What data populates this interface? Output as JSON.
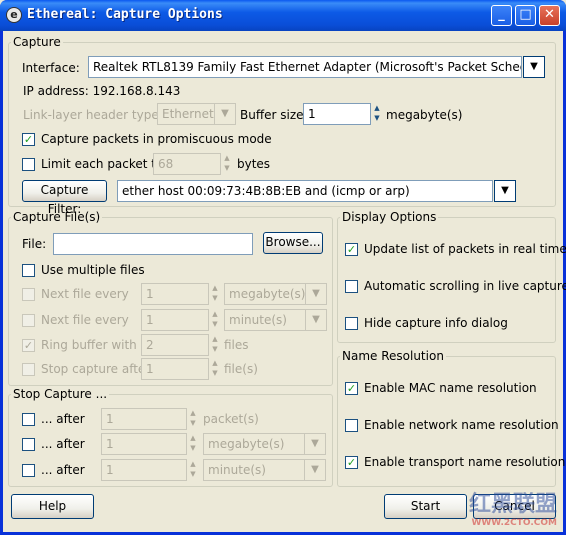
{
  "window": {
    "title": "Ethereal: Capture Options",
    "icon_letter": "e",
    "minimize_glyph": "_",
    "maximize_glyph": "□",
    "close_glyph": "✕"
  },
  "capture": {
    "legend": "Capture",
    "interface_label": "Interface:",
    "interface_value": "Realtek RTL8139 Family Fast Ethernet Adapter (Microsoft's Packet Scheduler)",
    "ip_address": "IP address: 192.168.8.143",
    "link_layer_label": "Link-layer header type:",
    "link_layer_value": "Ethernet",
    "buffer_label": "Buffer size:",
    "buffer_value": "1",
    "buffer_unit": "megabyte(s)",
    "promiscuous_label": "Capture packets in promiscuous mode",
    "promiscuous_checked": true,
    "limit_label": "Limit each packet to",
    "limit_value": "68",
    "limit_unit": "bytes",
    "filter_button": "Capture Filter:",
    "filter_value": "ether  host  00:09:73:4B:8B:EB and (icmp or arp)"
  },
  "capture_files": {
    "legend": "Capture File(s)",
    "file_label": "File:",
    "file_value": "",
    "browse_button": "Browse...",
    "multiple_files_label": "Use multiple files",
    "next_file_every_1": "Next file every",
    "next_file_value_1": "1",
    "next_file_unit_1": "megabyte(s)",
    "next_file_every_2": "Next file every",
    "next_file_value_2": "1",
    "next_file_unit_2": "minute(s)",
    "ring_buffer_label": "Ring buffer with",
    "ring_buffer_value": "2",
    "ring_buffer_unit": "files",
    "stop_after_label": "Stop capture after",
    "stop_after_value": "1",
    "stop_after_unit": "file(s)"
  },
  "stop_capture": {
    "legend": "Stop Capture ...",
    "rows": [
      {
        "label": "... after",
        "value": "1",
        "unit": "packet(s)"
      },
      {
        "label": "... after",
        "value": "1",
        "unit": "megabyte(s)"
      },
      {
        "label": "... after",
        "value": "1",
        "unit": "minute(s)"
      }
    ]
  },
  "display_options": {
    "legend": "Display Options",
    "update_realtime": "Update list of packets in real time",
    "auto_scroll": "Automatic scrolling in live capture",
    "hide_info": "Hide capture info dialog"
  },
  "name_resolution": {
    "legend": "Name Resolution",
    "mac": "Enable MAC name resolution",
    "network": "Enable network name resolution",
    "transport": "Enable transport name resolution"
  },
  "footer": {
    "help_button": "Help",
    "start_button": "Start",
    "cancel_button": "Cancel"
  },
  "watermark": {
    "text": "红黑联盟",
    "url": "WWW.2CTO.COM"
  },
  "glyphs": {
    "check": "✓",
    "dropdown": "▼",
    "spin_up": "▲",
    "spin_down": "▼"
  },
  "colors": {
    "titlebar": "#0a4ed8",
    "dialog_bg": "#ece9d8",
    "check": "#21a121"
  }
}
